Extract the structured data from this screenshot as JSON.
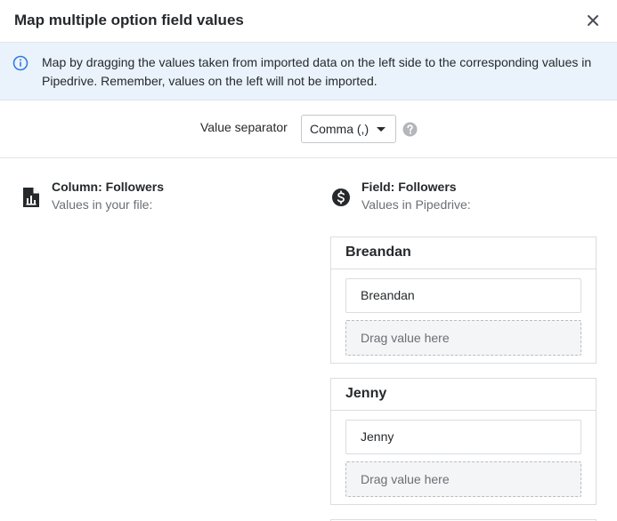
{
  "modal": {
    "title": "Map multiple option field values"
  },
  "info": {
    "text": "Map by dragging the values taken from imported data on the left side to the corresponding values in Pipedrive. Remember, values on the left will not be imported."
  },
  "separator": {
    "label": "Value separator",
    "selected": "Comma (,)"
  },
  "left_column": {
    "title": "Column: Followers",
    "subtitle": "Values in your file:"
  },
  "right_column": {
    "title": "Field: Followers",
    "subtitle": "Values in Pipedrive:"
  },
  "groups": [
    {
      "title": "Breandan",
      "value": "Breandan",
      "drop_label": "Drag value here"
    },
    {
      "title": "Jenny",
      "value": "Jenny",
      "drop_label": "Drag value here"
    }
  ],
  "colors": {
    "info_background": "#eaf3fc",
    "info_icon": "#317ae2",
    "text": "#26292c",
    "muted_text": "#6a6f75",
    "border": "#dadde1"
  }
}
